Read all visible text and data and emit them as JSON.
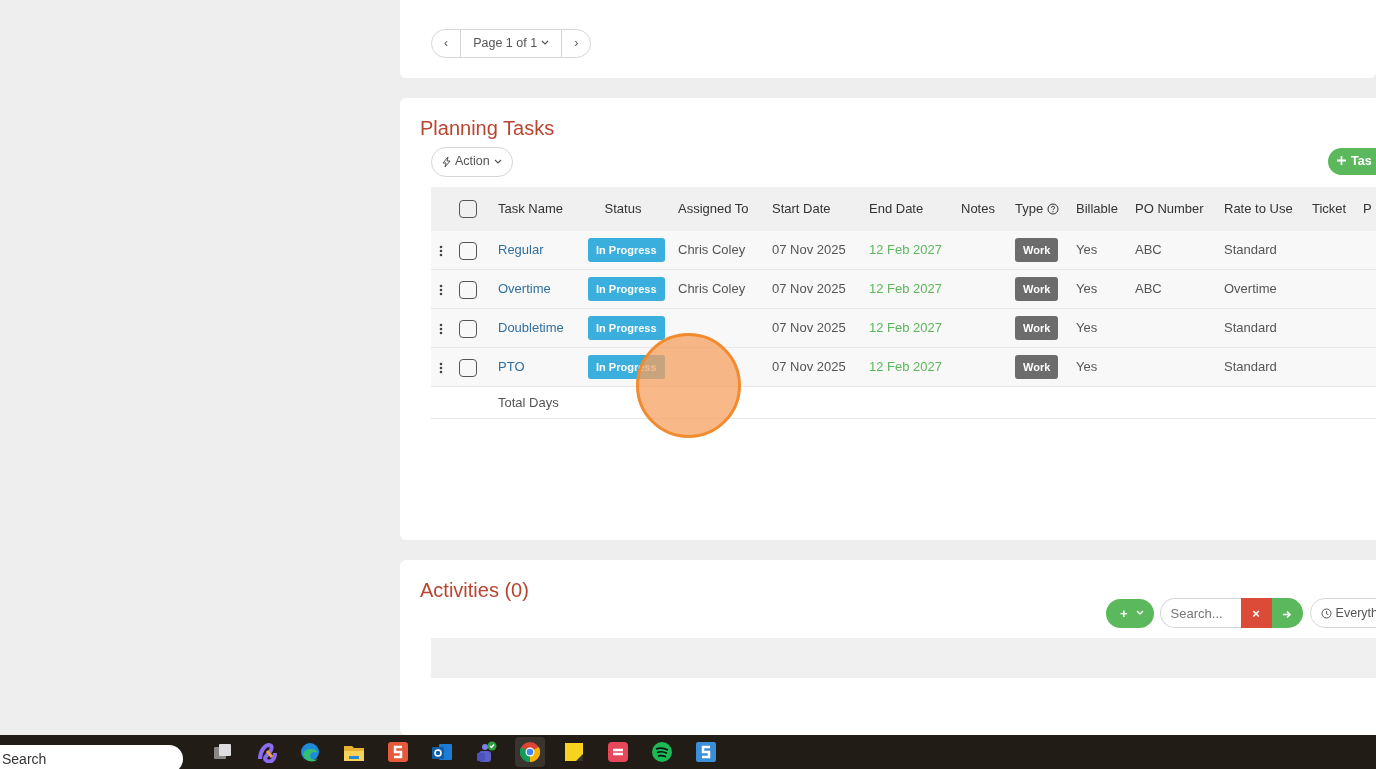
{
  "pager": {
    "prev": "‹",
    "label": "Page 1 of 1",
    "next": "›"
  },
  "planning": {
    "title": "Planning Tasks",
    "action_button": "Action",
    "add_button": "Tas",
    "select_all": {
      "checked": false
    },
    "columns": [
      "Task Name",
      "Status",
      "Assigned To",
      "Start Date",
      "End Date",
      "Notes",
      "Type",
      "Billable",
      "PO Number",
      "Rate to Use",
      "Ticket",
      "P"
    ],
    "rows": [
      {
        "selected": false,
        "name": "Regular",
        "status": "In Progress",
        "assigned": "Chris Coley",
        "start": "07 Nov 2025",
        "end": "12 Feb 2027",
        "type": "Work",
        "billable": "Yes",
        "po": "ABC",
        "rate": "Standard"
      },
      {
        "selected": false,
        "name": "Overtime",
        "status": "In Progress",
        "assigned": "Chris Coley",
        "start": "07 Nov 2025",
        "end": "12 Feb 2027",
        "type": "Work",
        "billable": "Yes",
        "po": "ABC",
        "rate": "Overtime"
      },
      {
        "selected": false,
        "name": "Doubletime",
        "status": "In Progress",
        "start": "07 Nov 2025",
        "end": "12 Feb 2027",
        "type": "Work",
        "billable": "Yes",
        "rate": "Standard"
      },
      {
        "selected": false,
        "name": "PTO",
        "status": "In Progress",
        "start": "07 Nov 2025",
        "end": "12 Feb 2027",
        "type": "Work",
        "billable": "Yes",
        "rate": "Standard"
      }
    ],
    "footer": "Total Days"
  },
  "activities": {
    "title": "Activities (0)",
    "add_icon": "+",
    "search": {
      "placeholder": "Search..."
    },
    "clear": "×",
    "filter": "Everyth"
  },
  "taskbar": {
    "search": "Search",
    "apps": [
      {
        "kind": "taskview",
        "selected": false
      },
      {
        "kind": "copilot",
        "selected": false
      },
      {
        "kind": "edge",
        "selected": false
      },
      {
        "kind": "folder",
        "selected": false
      },
      {
        "kind": "snag",
        "selected": false
      },
      {
        "kind": "outlook",
        "selected": false
      },
      {
        "kind": "teams",
        "selected": false
      },
      {
        "kind": "chrome",
        "selected": true
      },
      {
        "kind": "notes",
        "selected": false
      },
      {
        "kind": "red",
        "selected": false
      },
      {
        "kind": "spotify",
        "selected": false
      },
      {
        "kind": "snagblue",
        "selected": false
      }
    ]
  }
}
